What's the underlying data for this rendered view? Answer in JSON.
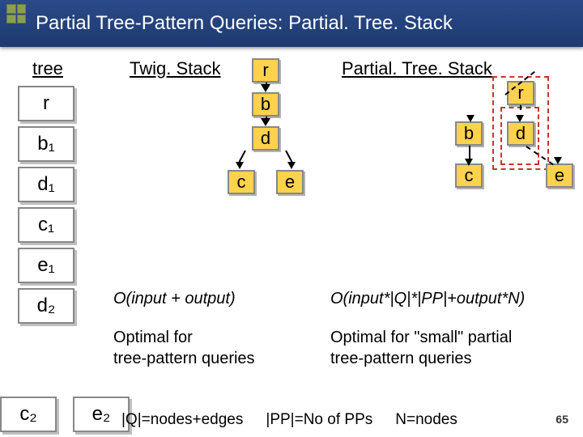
{
  "title": "Partial Tree-Pattern Queries: Partial. Tree. Stack",
  "tree_label": "tree",
  "sequence": [
    "r",
    "b₁",
    "d₁",
    "c₁",
    "e₁",
    "d₂"
  ],
  "bottom_pair": [
    "c₂",
    "e₂"
  ],
  "columns": {
    "twig": "Twig. Stack",
    "pts": "Partial. Tree. Stack"
  },
  "center_nodes": [
    "r",
    "b",
    "d",
    "c",
    "e"
  ],
  "right_nodes": {
    "r": "r",
    "b": "b",
    "d": "d",
    "c": "c",
    "e": "e"
  },
  "complexity": {
    "twig": "O(input + output)",
    "pts": "O(input*|Q|*|PP|+output*N)"
  },
  "optimal": {
    "twig_line1": "Optimal for",
    "twig_line2": "tree-pattern queries",
    "pts_line1": "Optimal for \"small\" partial",
    "pts_line2": "tree-pattern queries"
  },
  "footer": {
    "q": "|Q|=nodes+edges",
    "pp": "|PP|=No of PPs",
    "n": "N=nodes"
  },
  "slide_number": "65"
}
